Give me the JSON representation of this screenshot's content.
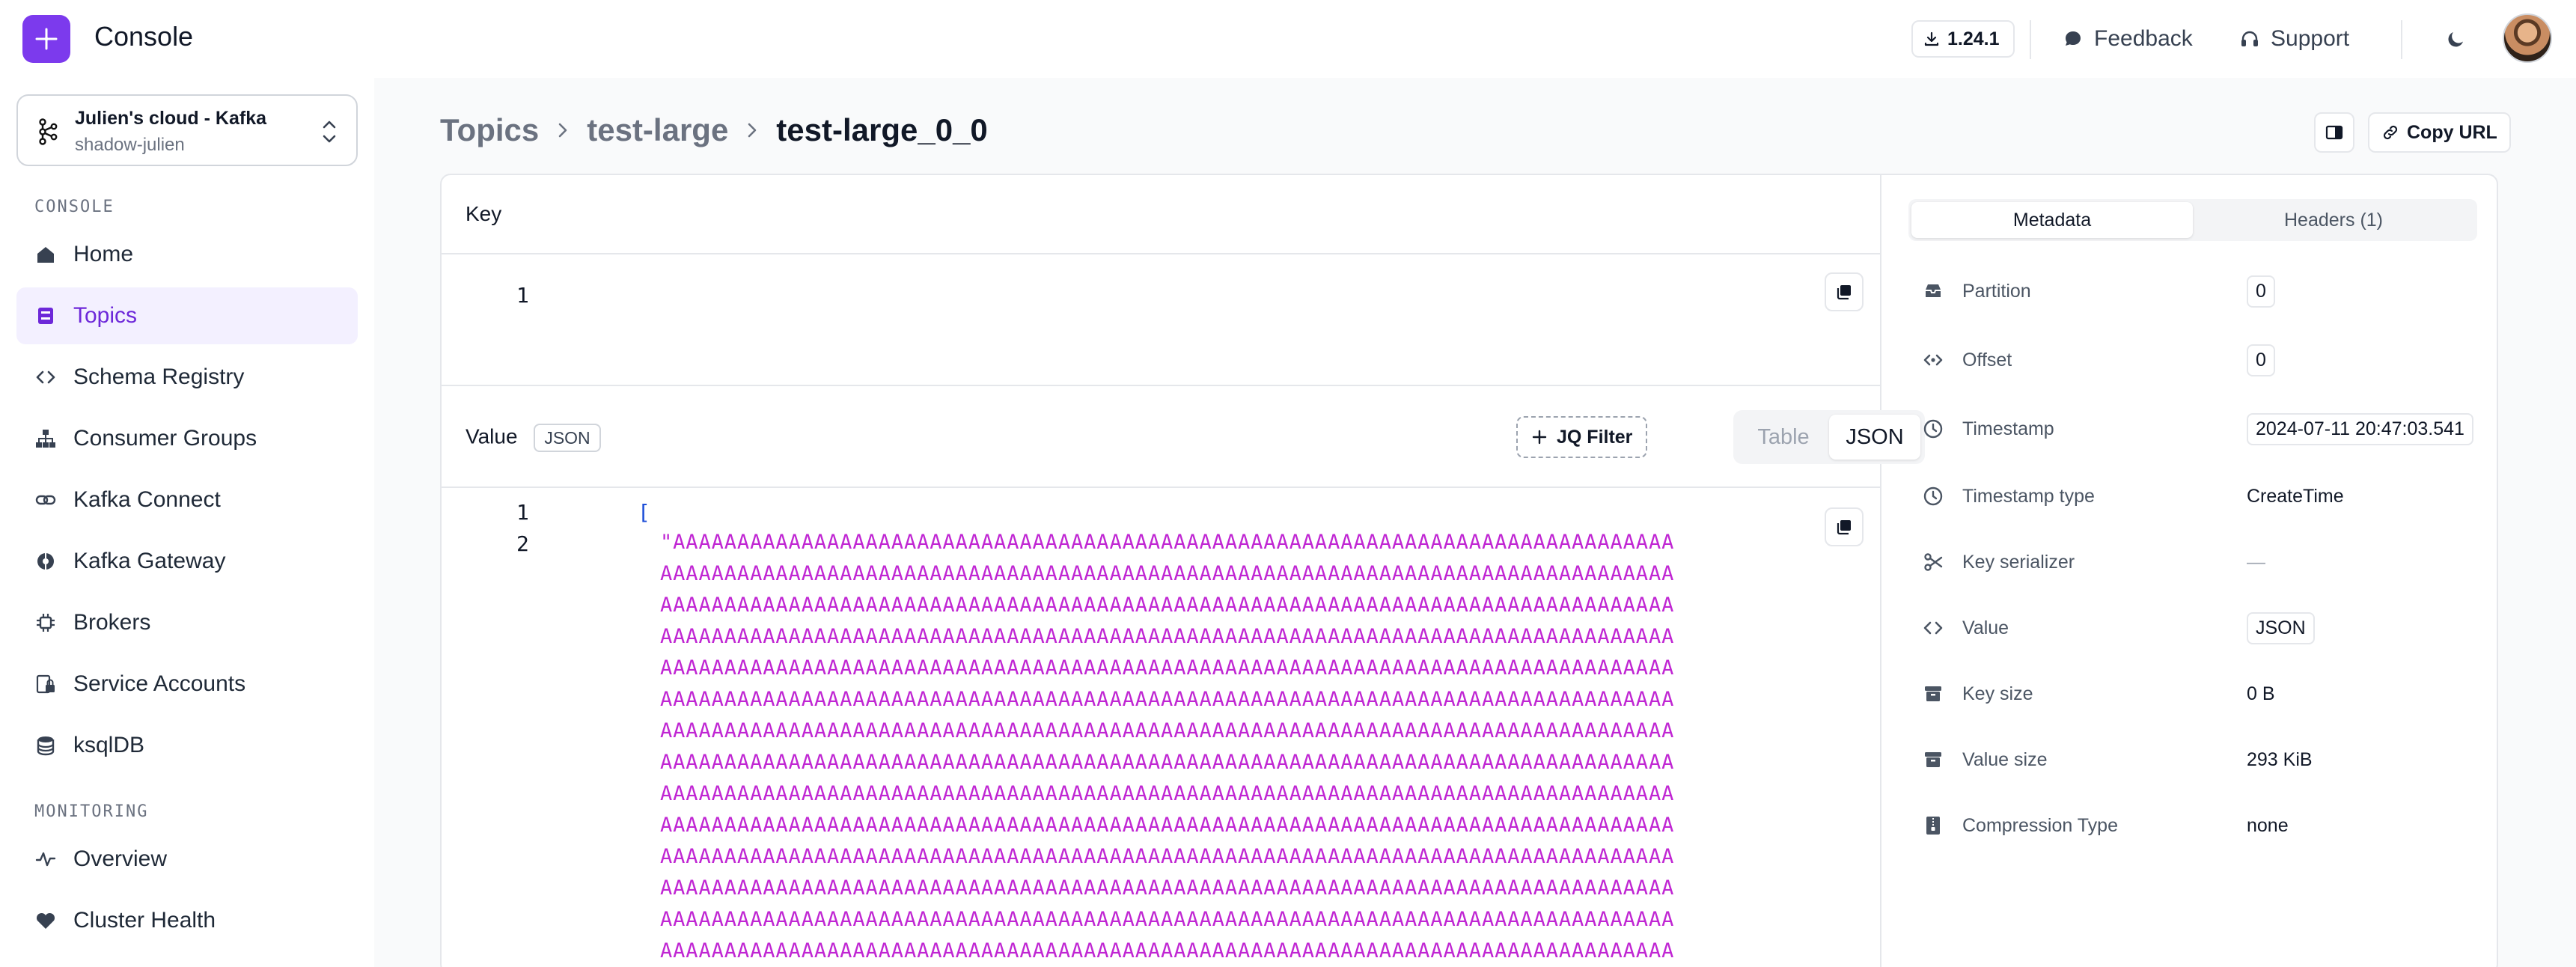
{
  "app": {
    "title": "Console",
    "version": "1.24.1"
  },
  "header": {
    "feedback": "Feedback",
    "support": "Support"
  },
  "cluster": {
    "name": "Julien's cloud - Kafka",
    "sub": "shadow-julien"
  },
  "sidebar": {
    "console_label": "CONSOLE",
    "monitoring_label": "MONITORING",
    "items": [
      {
        "label": "Home",
        "icon": "home-icon"
      },
      {
        "label": "Topics",
        "icon": "topics-icon",
        "active": true
      },
      {
        "label": "Schema Registry",
        "icon": "code-icon"
      },
      {
        "label": "Consumer Groups",
        "icon": "hierarchy-icon"
      },
      {
        "label": "Kafka Connect",
        "icon": "link-icon"
      },
      {
        "label": "Kafka Gateway",
        "icon": "gateway-icon"
      },
      {
        "label": "Brokers",
        "icon": "chip-icon"
      },
      {
        "label": "Service Accounts",
        "icon": "lock-icon"
      },
      {
        "label": "ksqlDB",
        "icon": "database-icon"
      }
    ],
    "monitoring_items": [
      {
        "label": "Overview",
        "icon": "activity-icon"
      },
      {
        "label": "Cluster Health",
        "icon": "heart-icon"
      }
    ]
  },
  "breadcrumb": {
    "topics": "Topics",
    "topic": "test-large",
    "message": "test-large_0_0"
  },
  "toolbar": {
    "copy_url": "Copy URL"
  },
  "message": {
    "key_title": "Key",
    "key_line": "1",
    "value_title": "Value",
    "value_format": "JSON",
    "jq_filter": "JQ Filter",
    "view_table": "Table",
    "view_json": "JSON",
    "line_1": "1",
    "line_2": "2",
    "open_bracket": "[",
    "value_first": "\"AAAAAAAAAAAAAAAAAAAAAAAAAAAAAAAAAAAAAAAAAAAAAAAAAAAAAAAAAAAAAAAAAAAAAAAAAAAAAA",
    "value_line": "AAAAAAAAAAAAAAAAAAAAAAAAAAAAAAAAAAAAAAAAAAAAAAAAAAAAAAAAAAAAAAAAAAAAAAAAAAAAAAA"
  },
  "tabs": {
    "metadata": "Metadata",
    "headers": "Headers (1)"
  },
  "metadata": {
    "partition_label": "Partition",
    "partition": "0",
    "offset_label": "Offset",
    "offset": "0",
    "timestamp_label": "Timestamp",
    "timestamp": "2024-07-11 20:47:03.541",
    "timestamp_type_label": "Timestamp type",
    "timestamp_type": "CreateTime",
    "key_serializer_label": "Key serializer",
    "key_serializer": "—",
    "value_label": "Value",
    "value": "JSON",
    "key_size_label": "Key size",
    "key_size": "0 B",
    "value_size_label": "Value size",
    "value_size": "293 KiB",
    "compression_label": "Compression Type",
    "compression": "none"
  },
  "colors": {
    "accent": "#7c3aed",
    "string": "#c026d3",
    "bracket": "#1d4ed8"
  }
}
